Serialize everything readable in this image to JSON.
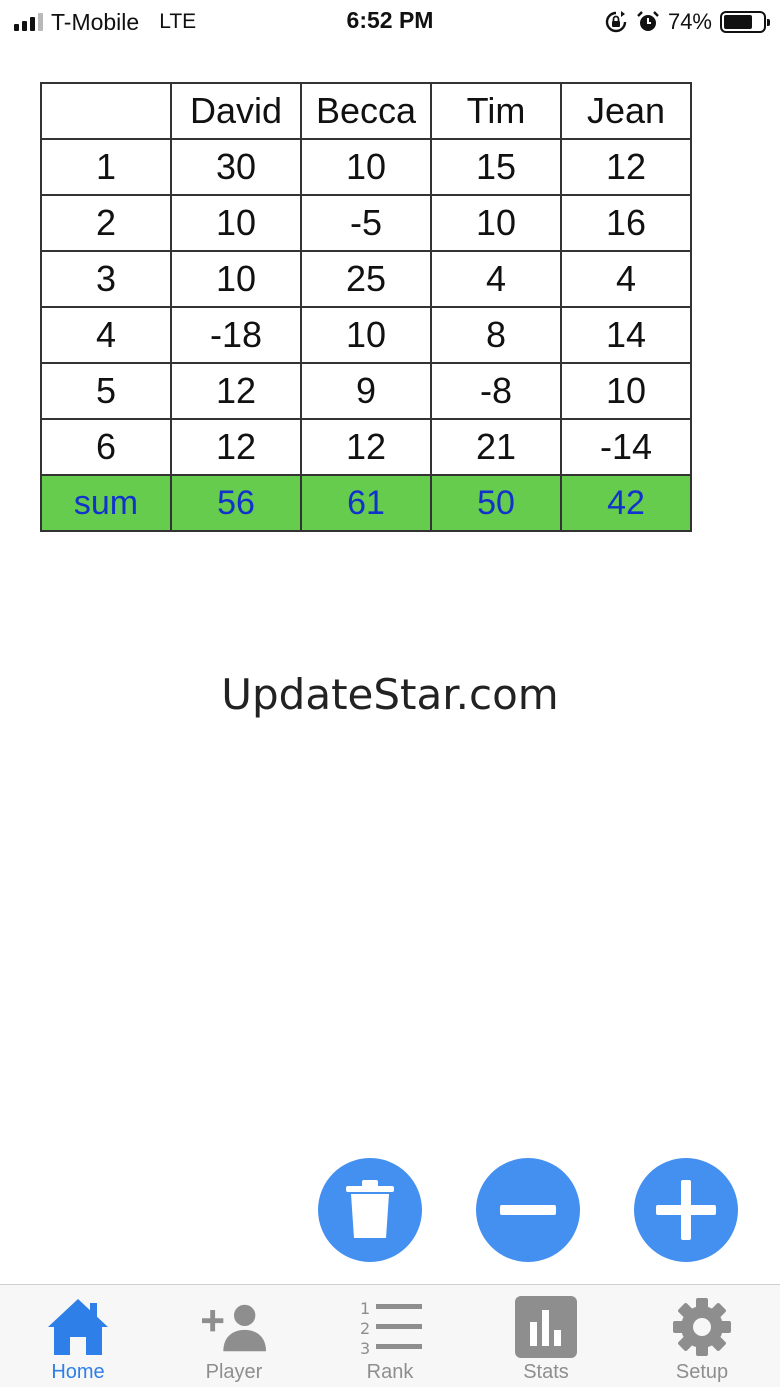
{
  "status_bar": {
    "carrier": "T-Mobile",
    "network": "LTE",
    "time": "6:52 PM",
    "battery_percent": "74%",
    "battery_level": 0.74,
    "icons": [
      "signal-icon",
      "orientation-lock-icon",
      "alarm-icon",
      "battery-icon"
    ]
  },
  "score_table": {
    "headers": [
      "",
      "David",
      "Becca",
      "Tim",
      "Jean"
    ],
    "rows": [
      [
        "1",
        "30",
        "10",
        "15",
        "12"
      ],
      [
        "2",
        "10",
        "-5",
        "10",
        "16"
      ],
      [
        "3",
        "10",
        "25",
        "4",
        "4"
      ],
      [
        "4",
        "-18",
        "10",
        "8",
        "14"
      ],
      [
        "5",
        "12",
        "9",
        "-8",
        "10"
      ],
      [
        "6",
        "12",
        "12",
        "21",
        "-14"
      ]
    ],
    "sum_row": [
      "sum",
      "56",
      "61",
      "50",
      "42"
    ],
    "sum_row_color": "#66cc4d",
    "sum_text_color": "#1133cc"
  },
  "watermark": "UpdateStar.com",
  "actions": {
    "color": "#4490f0",
    "buttons": [
      {
        "icon": "trash-icon"
      },
      {
        "icon": "minus-icon"
      },
      {
        "icon": "plus-icon"
      }
    ]
  },
  "tab_bar": {
    "active_color": "#2f7fe8",
    "inactive_color": "#8e8e8e",
    "tabs": [
      {
        "label": "Home",
        "icon": "home-icon",
        "active": true
      },
      {
        "label": "Player",
        "icon": "add-player-icon",
        "active": false
      },
      {
        "label": "Rank",
        "icon": "ranked-list-icon",
        "active": false
      },
      {
        "label": "Stats",
        "icon": "stats-icon",
        "active": false
      },
      {
        "label": "Setup",
        "icon": "gear-icon",
        "active": false
      }
    ]
  }
}
